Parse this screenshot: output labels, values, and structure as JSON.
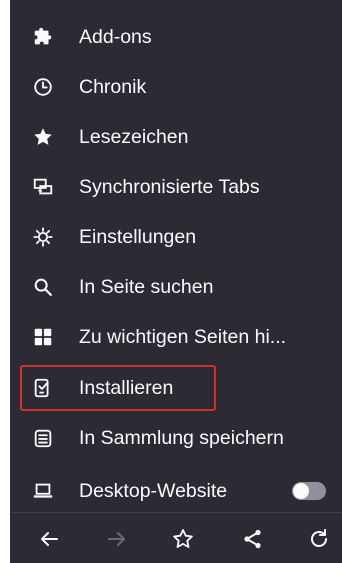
{
  "menu": {
    "items": [
      {
        "label": "Add-ons",
        "icon": "puzzle-icon"
      },
      {
        "label": "Chronik",
        "icon": "clock-icon"
      },
      {
        "label": "Lesezeichen",
        "icon": "star-filled-icon"
      },
      {
        "label": "Synchronisierte Tabs",
        "icon": "synced-tabs-icon"
      },
      {
        "label": "Einstellungen",
        "icon": "gear-icon"
      },
      {
        "label": "In Seite suchen",
        "icon": "search-icon"
      },
      {
        "label": "Zu wichtigen Seiten hi...",
        "icon": "grid-icon"
      },
      {
        "label": "Installieren",
        "icon": "install-phone-icon"
      },
      {
        "label": "In Sammlung speichern",
        "icon": "collection-icon"
      },
      {
        "label": "Desktop-Website",
        "icon": "laptop-icon"
      }
    ],
    "desktop_toggle_on": false,
    "highlighted_item": "Installieren"
  },
  "navbar": {
    "buttons": [
      {
        "icon": "back-arrow-icon",
        "enabled": true
      },
      {
        "icon": "forward-arrow-icon",
        "enabled": false
      },
      {
        "icon": "star-outline-icon",
        "enabled": true
      },
      {
        "icon": "share-icon",
        "enabled": true
      },
      {
        "icon": "reload-icon",
        "enabled": true
      }
    ]
  },
  "colors": {
    "background": "#2c2a33",
    "text": "#fbfbfe",
    "highlight_border": "#d4302b",
    "disabled": "#6b6a72"
  }
}
